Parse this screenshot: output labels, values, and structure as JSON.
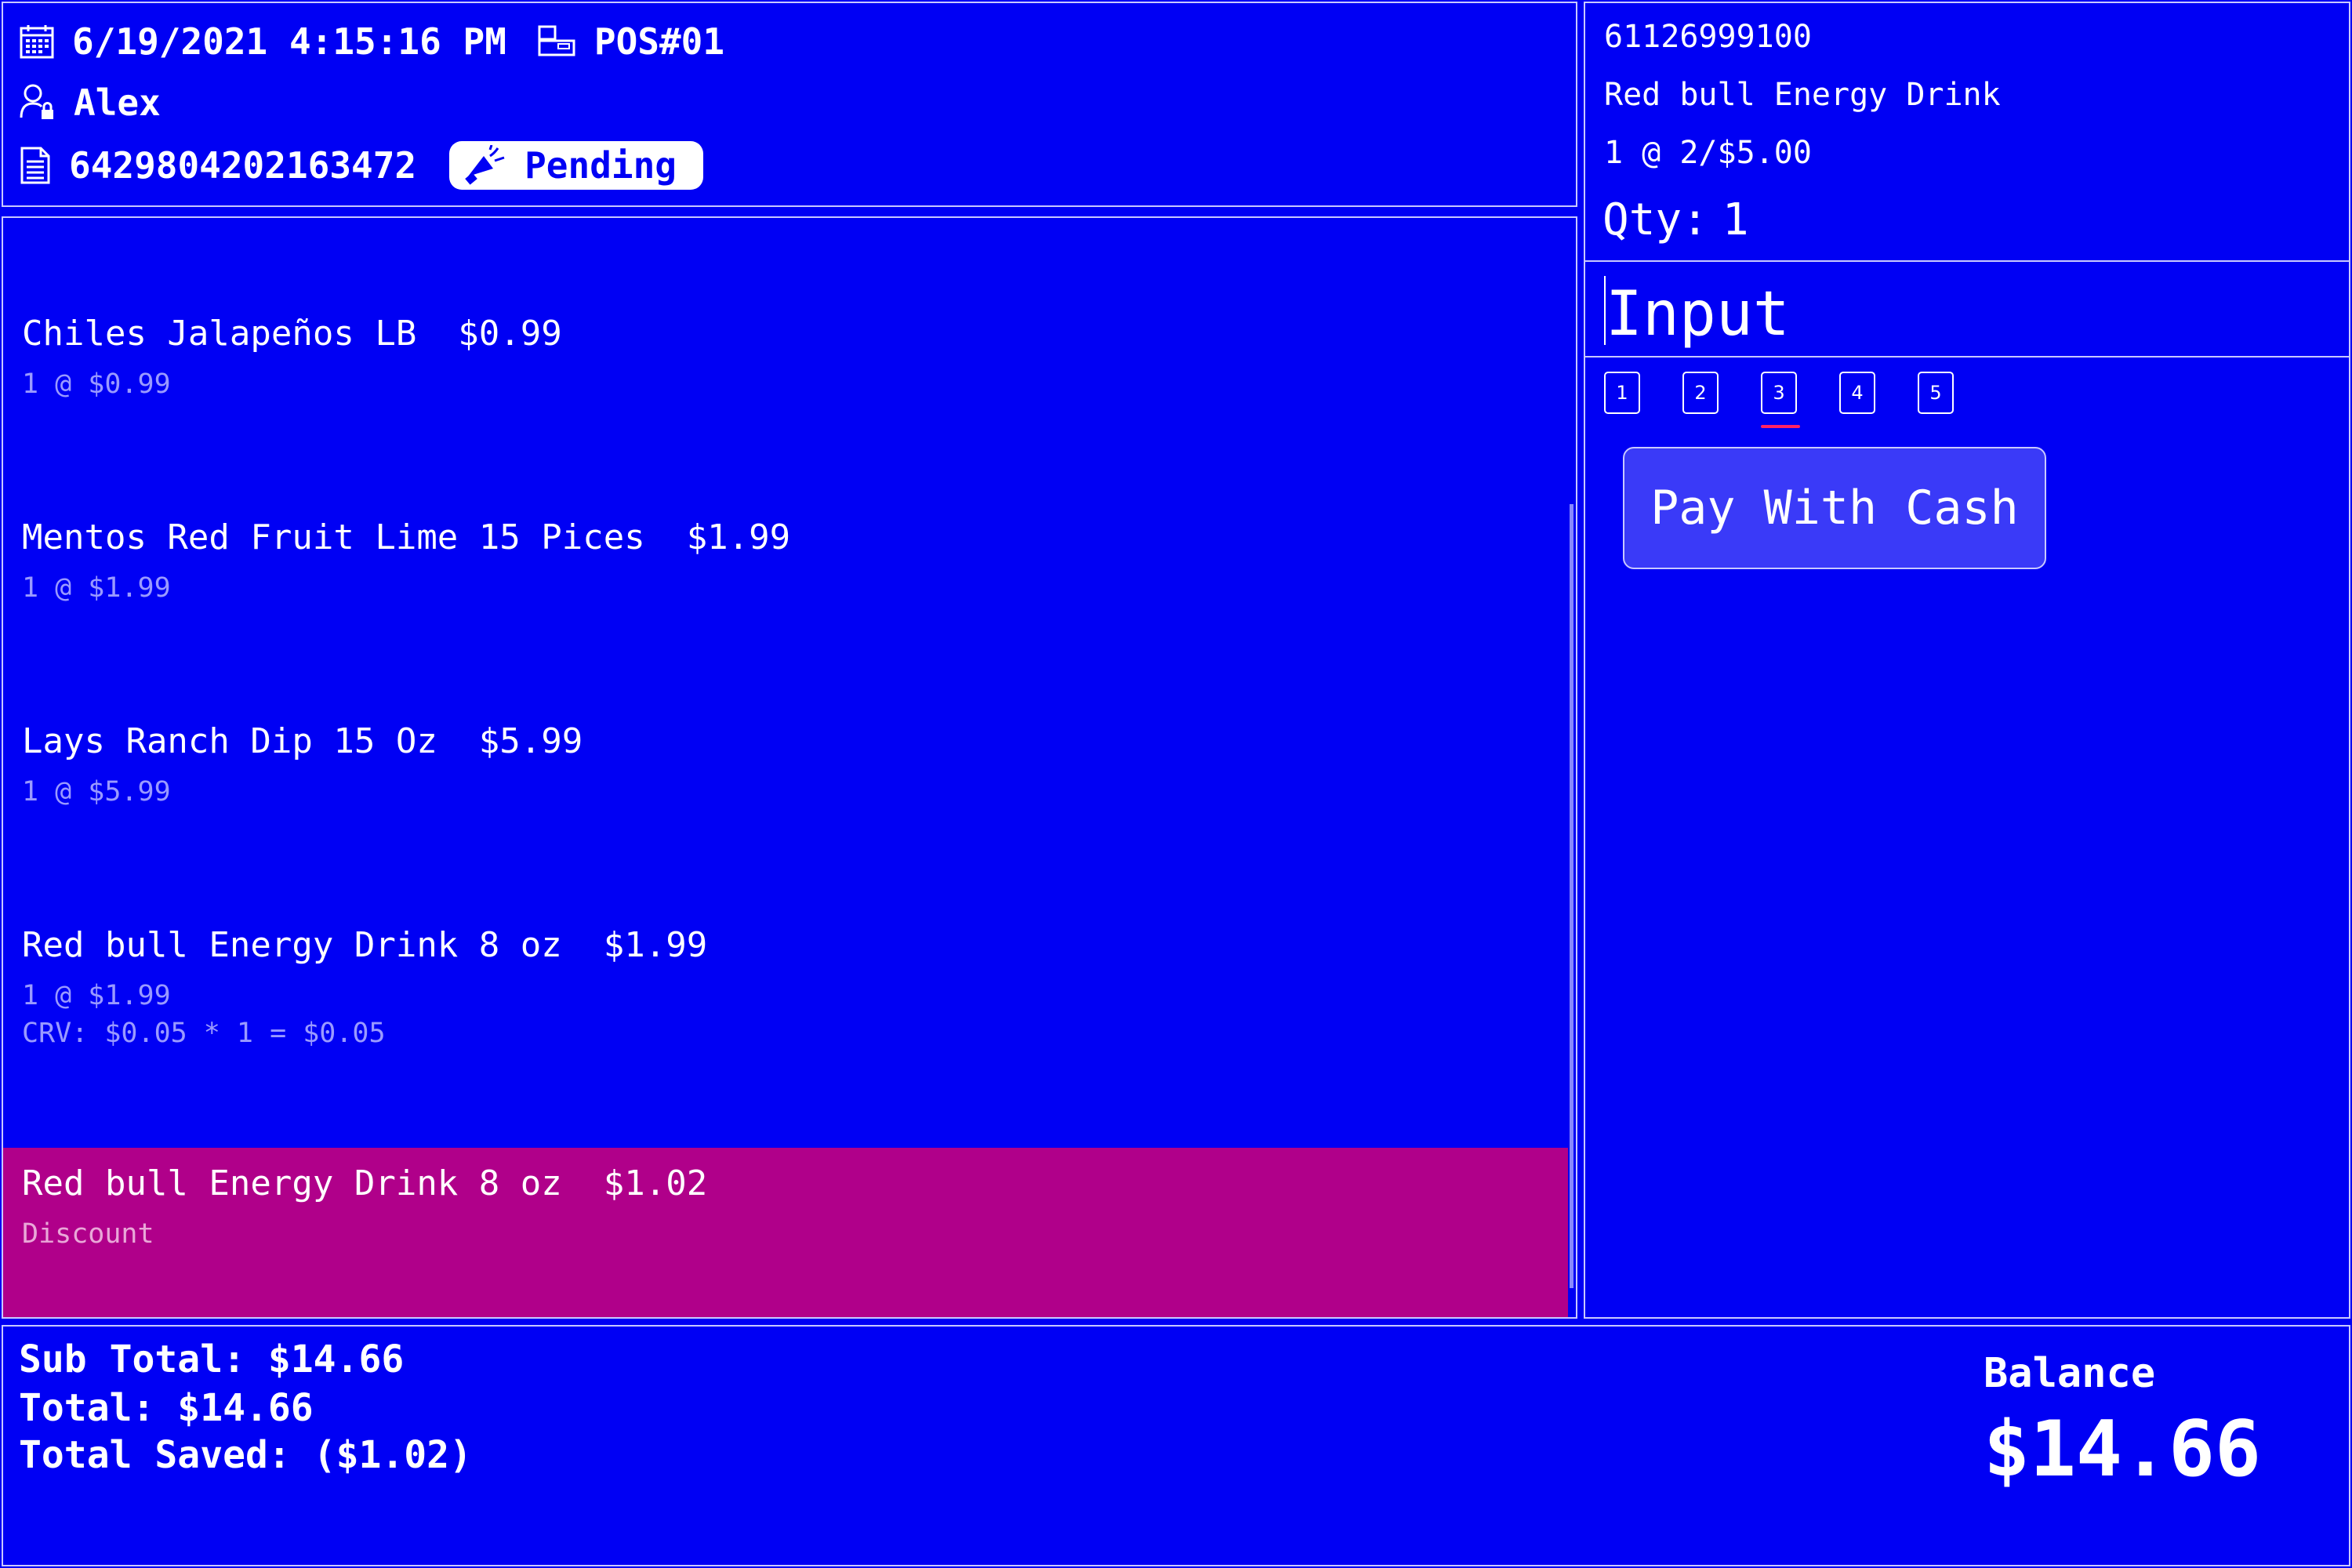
{
  "header": {
    "datetime": "6/19/2021 4:15:16 PM",
    "pos": "POS#01",
    "user": "Alex",
    "order_id": "6429804202163472",
    "status": "Pending",
    "icons": [
      "calendar-icon",
      "register-icon",
      "user-lock-icon",
      "receipt-icon",
      "megaphone-icon"
    ]
  },
  "items": [
    {
      "title": "Chiles Jalapeños LB  $0.99",
      "sub": "1 @ $0.99",
      "sub2": ""
    },
    {
      "title": "Mentos Red Fruit Lime 15 Pices  $1.99",
      "sub": "1 @ $1.99",
      "sub2": ""
    },
    {
      "title": "Lays Ranch Dip 15 Oz  $5.99",
      "sub": "1 @ $5.99",
      "sub2": ""
    },
    {
      "title": "Red bull Energy Drink 8 oz  $1.99",
      "sub": "1 @ $1.99",
      "sub2": "CRV: $0.05 * 1 = $0.05"
    },
    {
      "title": "Red bull Energy Drink 8 oz  $1.02",
      "sub": "Discount",
      "sub2": "",
      "highlighted": true
    }
  ],
  "selected": {
    "barcode": "61126999100",
    "name": "Red bull Energy Drink",
    "price_rule": "1 @ 2/$5.00",
    "qty_label": "Qty:",
    "qty_value": "1"
  },
  "input": {
    "label": "Input"
  },
  "pages": [
    "1",
    "2",
    "3",
    "4",
    "5"
  ],
  "active_page": "3",
  "pay_button": "Pay With Cash",
  "totals": {
    "subtotal": "Sub Total: $14.66",
    "total": "Total: $14.66",
    "saved": "Total Saved: ($1.02)",
    "balance_label": "Balance",
    "balance_value": "$14.66"
  },
  "colors": {
    "background": "#0000f4",
    "highlight": "#b0008a",
    "muted_text": "#9a9aff",
    "page_underline": "#ff2266"
  }
}
